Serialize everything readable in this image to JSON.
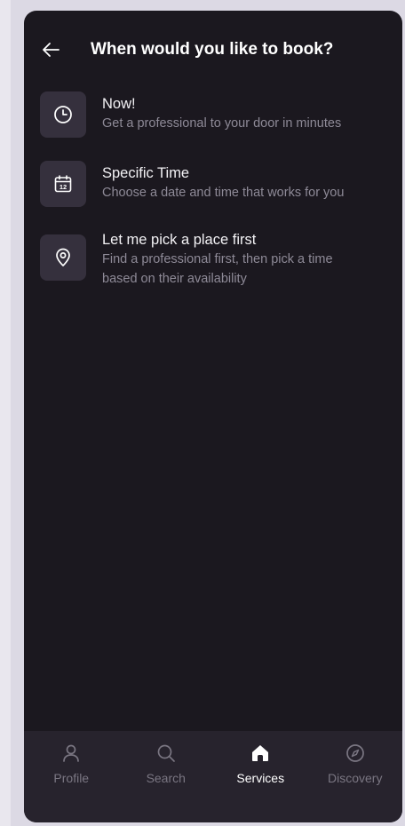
{
  "header": {
    "title": "When would you like to book?",
    "back_icon": "arrow-left-icon"
  },
  "options": [
    {
      "icon": "clock-icon",
      "title": "Now!",
      "subtitle": "Get a professional to your door in minutes"
    },
    {
      "icon": "calendar-icon",
      "calendar_day": "12",
      "title": "Specific Time",
      "subtitle": "Choose a date and time that works for you"
    },
    {
      "icon": "location-pin-icon",
      "title": "Let me pick a place first",
      "subtitle_line1": "Find a professional first, then pick a time",
      "subtitle_line2": "based on their availability"
    }
  ],
  "nav": {
    "active": "Services",
    "items": [
      {
        "label": "Profile",
        "icon": "user-icon"
      },
      {
        "label": "Search",
        "icon": "search-icon"
      },
      {
        "label": "Services",
        "icon": "home-icon"
      },
      {
        "label": "Discovery",
        "icon": "compass-icon"
      }
    ]
  },
  "colors": {
    "background": "#1b181f",
    "icon_tile": "#35303d",
    "nav_bar": "#27232d",
    "text_primary": "#ffffff",
    "text_secondary": "#8e8a97"
  }
}
